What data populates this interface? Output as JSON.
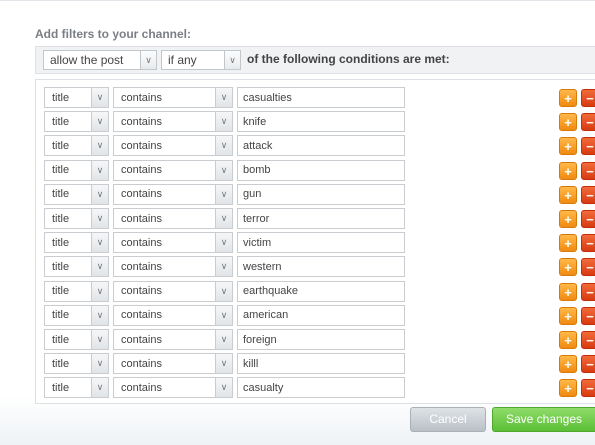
{
  "heading": "Add filters to your channel:",
  "rule": {
    "action": "allow the post",
    "quantifier": "if any",
    "suffix": "of the following conditions are met:"
  },
  "conditions": [
    {
      "field": "title",
      "operator": "contains",
      "value": "casualties"
    },
    {
      "field": "title",
      "operator": "contains",
      "value": "knife"
    },
    {
      "field": "title",
      "operator": "contains",
      "value": "attack"
    },
    {
      "field": "title",
      "operator": "contains",
      "value": "bomb"
    },
    {
      "field": "title",
      "operator": "contains",
      "value": "gun"
    },
    {
      "field": "title",
      "operator": "contains",
      "value": "terror"
    },
    {
      "field": "title",
      "operator": "contains",
      "value": "victim"
    },
    {
      "field": "title",
      "operator": "contains",
      "value": "western"
    },
    {
      "field": "title",
      "operator": "contains",
      "value": "earthquake"
    },
    {
      "field": "title",
      "operator": "contains",
      "value": "american"
    },
    {
      "field": "title",
      "operator": "contains",
      "value": "foreign"
    },
    {
      "field": "title",
      "operator": "contains",
      "value": "killl"
    },
    {
      "field": "title",
      "operator": "contains",
      "value": "casualty"
    }
  ],
  "icons": {
    "caret": "chevron-down-icon",
    "add": "plus-icon",
    "remove": "minus-icon"
  },
  "buttons": {
    "cancel": "Cancel",
    "save": "Save changes"
  },
  "colors": {
    "add": "#f08a10",
    "remove": "#d83a10",
    "save": "#5bbf36",
    "cancel": "#b9c0c7"
  }
}
